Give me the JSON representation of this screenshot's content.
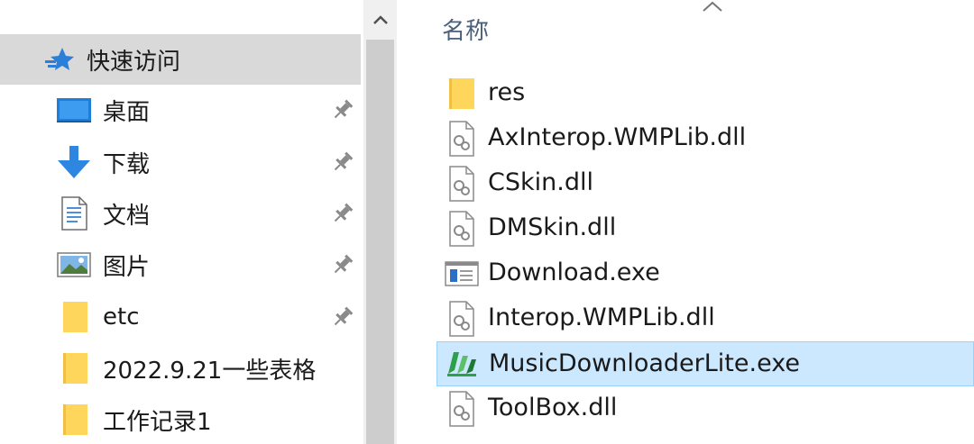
{
  "nav": {
    "items": [
      {
        "label": "快速访问",
        "icon": "quick-access-star-icon",
        "pinned": false,
        "selected": true
      },
      {
        "label": "桌面",
        "icon": "desktop-icon",
        "pinned": true
      },
      {
        "label": "下载",
        "icon": "download-arrow-icon",
        "pinned": true
      },
      {
        "label": "文档",
        "icon": "documents-icon",
        "pinned": true
      },
      {
        "label": "图片",
        "icon": "pictures-icon",
        "pinned": true
      },
      {
        "label": "etc",
        "icon": "folder-icon",
        "pinned": true
      },
      {
        "label": "2022.9.21一些表格",
        "icon": "folder-icon",
        "pinned": false
      },
      {
        "label": "工作记录1",
        "icon": "folder-icon",
        "pinned": false
      }
    ]
  },
  "file_list": {
    "column_header": "名称",
    "files": [
      {
        "name": "res",
        "icon": "folder-icon"
      },
      {
        "name": "AxInterop.WMPLib.dll",
        "icon": "dll-file-icon"
      },
      {
        "name": "CSkin.dll",
        "icon": "dll-file-icon"
      },
      {
        "name": "DMSkin.dll",
        "icon": "dll-file-icon"
      },
      {
        "name": "Download.exe",
        "icon": "exe-window-icon"
      },
      {
        "name": "Interop.WMPLib.dll",
        "icon": "dll-file-icon"
      },
      {
        "name": "MusicDownloaderLite.exe",
        "icon": "music-downloader-app-icon",
        "selected": true
      },
      {
        "name": "ToolBox.dll",
        "icon": "dll-file-icon"
      }
    ]
  },
  "colors": {
    "selection_bg": "#cce8ff",
    "selection_border": "#99d1ff",
    "nav_selected_bg": "#d9d9d9",
    "folder_yellow": "#ffd65c",
    "header_text": "#4c607a"
  }
}
